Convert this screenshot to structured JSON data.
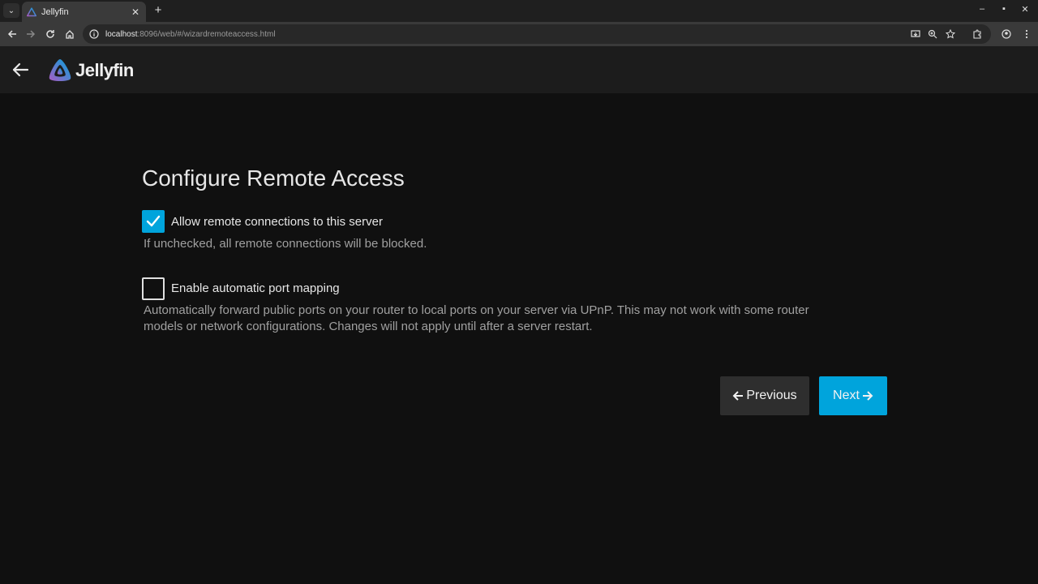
{
  "browser": {
    "tab_title": "Jellyfin",
    "url_host": "localhost",
    "url_rest": ":8096/web/#/wizardremoteaccess.html"
  },
  "app": {
    "brand": "Jellyfin",
    "accent_color": "#00a4dc"
  },
  "page": {
    "title": "Configure Remote Access",
    "options": [
      {
        "label": "Allow remote connections to this server",
        "checked": true,
        "description": "If unchecked, all remote connections will be blocked."
      },
      {
        "label": "Enable automatic port mapping",
        "checked": false,
        "description_line1": "Automatically forward public ports on your router to local ports on your server via UPnP. This may not work with some router",
        "description_line2": "models or network configurations. Changes will not apply until after a server restart."
      }
    ],
    "buttons": {
      "previous": "Previous",
      "next": "Next"
    }
  }
}
